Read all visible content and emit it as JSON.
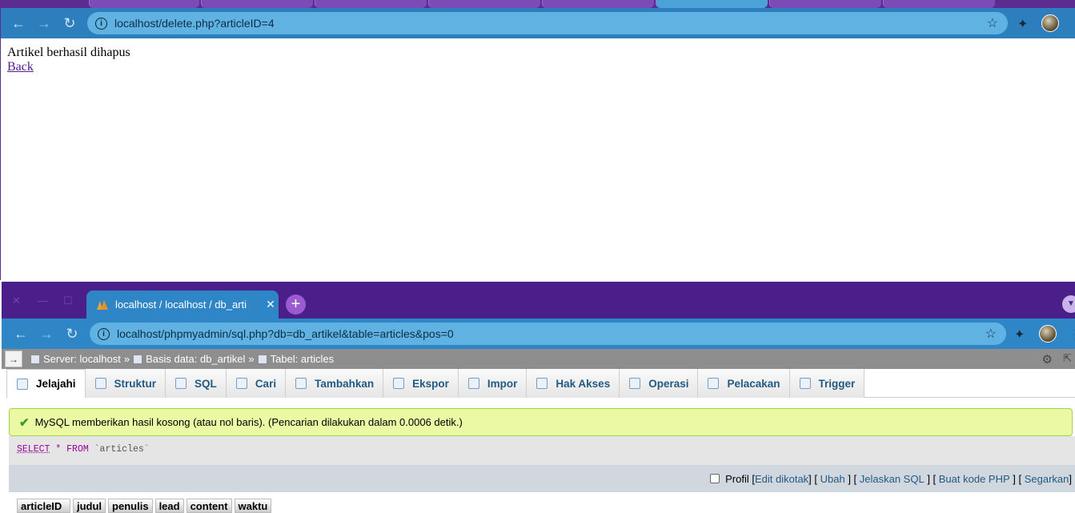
{
  "browser_top": {
    "url": "localhost/delete.php?articleID=4",
    "page": {
      "message": "Artikel berhasil dihapus",
      "back_link": "Back"
    }
  },
  "browser_bottom": {
    "tab_title": "localhost / localhost / db_arti",
    "url": "localhost/phpmyadmin/sql.php?db=db_artikel&table=articles&pos=0"
  },
  "pma": {
    "breadcrumb": {
      "server": "Server: localhost",
      "database": "Basis data: db_artikel",
      "table": "Tabel: articles",
      "sep": "»"
    },
    "tabs": [
      {
        "label": "Jelajahi",
        "icon": "browse-icon"
      },
      {
        "label": "Struktur",
        "icon": "structure-icon"
      },
      {
        "label": "SQL",
        "icon": "sql-icon"
      },
      {
        "label": "Cari",
        "icon": "search-icon"
      },
      {
        "label": "Tambahkan",
        "icon": "insert-icon"
      },
      {
        "label": "Ekspor",
        "icon": "export-icon"
      },
      {
        "label": "Impor",
        "icon": "import-icon"
      },
      {
        "label": "Hak Akses",
        "icon": "privileges-icon"
      },
      {
        "label": "Operasi",
        "icon": "wrench-icon"
      },
      {
        "label": "Pelacakan",
        "icon": "eye-icon"
      },
      {
        "label": "Trigger",
        "icon": "trigger-icon"
      }
    ],
    "success_message": "MySQL memberikan hasil kosong (atau nol baris). (Pencarian dilakukan dalam 0.0006 detik.)",
    "sql": {
      "select": "SELECT",
      "star": "*",
      "from": "FROM",
      "table": "`articles`"
    },
    "ops": {
      "profil": "Profil",
      "edit_inline": "Edit dikotak",
      "ubah": "Ubah",
      "jelaskan": "Jelaskan SQL",
      "php": "Buat kode PHP",
      "segarkan": "Segarkan"
    },
    "columns": [
      "articleID",
      "judul",
      "penulis",
      "lead",
      "content",
      "waktu"
    ]
  },
  "colors": {
    "accent": "#2f86c6",
    "tabstrip": "#4b1f8a",
    "success_bg": "#ebf8a4",
    "link": "#235a81"
  }
}
